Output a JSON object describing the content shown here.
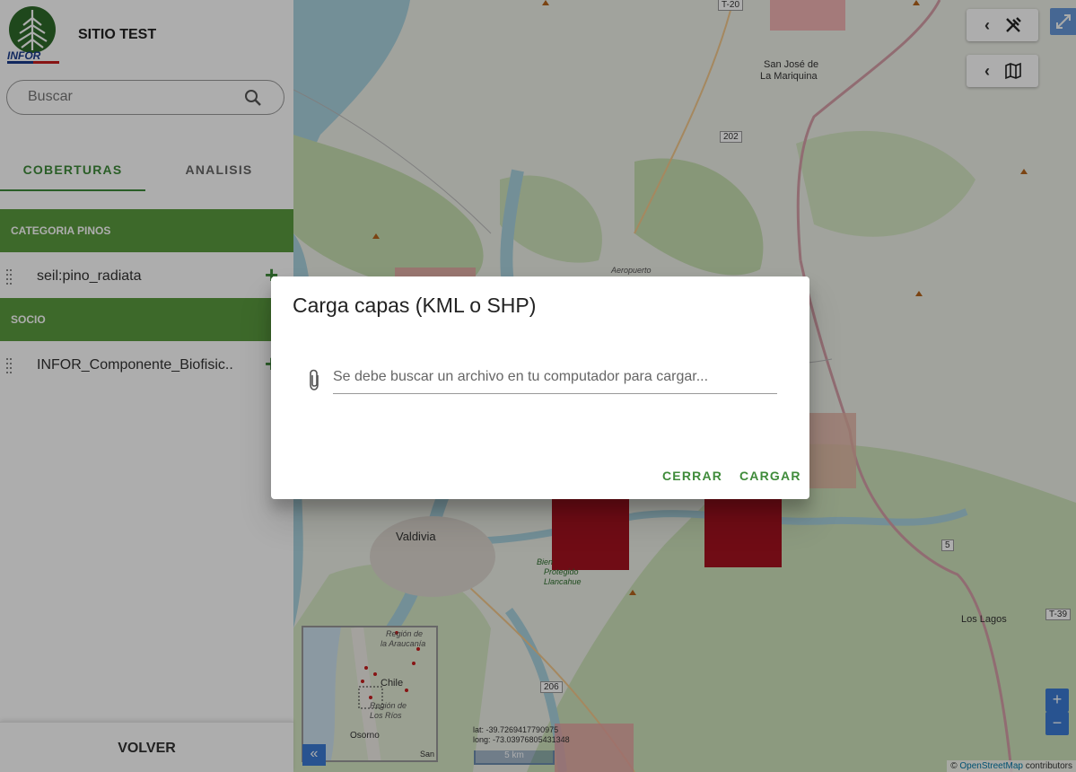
{
  "header": {
    "site_title": "SITIO TEST",
    "logo_text": "INFOR"
  },
  "search": {
    "placeholder": "Buscar",
    "icon": "search-icon"
  },
  "tabs": [
    {
      "label": "COBERTURAS",
      "active": true
    },
    {
      "label": "ANALISIS",
      "active": false
    }
  ],
  "categories": [
    {
      "label": "CATEGORIA PINOS",
      "layers": [
        {
          "name": "seil:pino_radiata",
          "action": "+"
        }
      ]
    },
    {
      "label": "SOCIO",
      "layers": [
        {
          "name": "INFOR_Componente_Biofisic..",
          "action": "+"
        }
      ]
    }
  ],
  "footer": {
    "volver_label": "VOLVER"
  },
  "map": {
    "labels": {
      "san_jose": "San José de",
      "mariquina": "La Mariquina",
      "aeropuerto": "Aeropuerto",
      "valdivia": "Valdivia",
      "los_lagos": "Los Lagos",
      "bien": "Bien",
      "protegido": "Protegido",
      "llancahue": "Llancahue"
    },
    "shields": {
      "t20": "T-20",
      "r202": "202",
      "r206": "206",
      "r5": "5",
      "t39": "T-39"
    },
    "overview_labels": {
      "region": "Región de",
      "araucania": "la Araucanía",
      "chile": "Chile",
      "region2": "Región de",
      "los_rios": "Los Ríos",
      "osorno": "Osorno",
      "san": "San"
    },
    "overview_toggle": "«",
    "coords": {
      "lat": "lat: -39.7269417790975",
      "long": "long: -73.03976805431348"
    },
    "scale": "5 km",
    "zoom_in": "+",
    "zoom_out": "−",
    "attribution_prefix": "©",
    "attribution_link": "OpenStreetMap",
    "attribution_suffix": "contributors",
    "tools_icon": "tools-icon",
    "layers_icon": "map-icon"
  },
  "dialog": {
    "title": "Carga capas (KML o SHP)",
    "file_placeholder": "Se debe buscar un archivo en tu computador para cargar...",
    "close_label": "CERRAR",
    "load_label": "CARGAR"
  },
  "colors": {
    "accent_green": "#3f8b3a",
    "category_green": "#5b9b3f",
    "polygon_red": "#a51220",
    "control_blue": "#3b7bd4"
  }
}
